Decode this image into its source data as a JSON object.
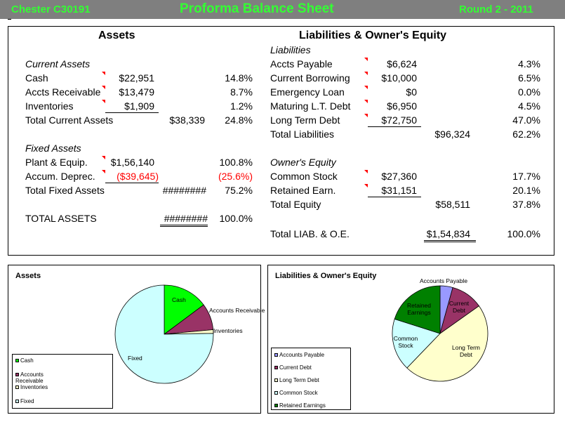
{
  "header": {
    "company": "Chester C30191",
    "title": "Proforma Balance Sheet",
    "round": "Round 2 - 2011"
  },
  "assets": {
    "heading": "Assets",
    "current_heading": "Current Assets",
    "cash": {
      "label": "Cash",
      "value": "$22,951",
      "pct": "14.8%"
    },
    "receivable": {
      "label": "Accts Receivable",
      "value": "$13,479",
      "pct": "8.7%"
    },
    "inventories": {
      "label": "Inventories",
      "value": "$1,909",
      "pct": "1.2%"
    },
    "total_current": {
      "label": "Total Current Assets",
      "value": "$38,339",
      "pct": "24.8%"
    },
    "fixed_heading": "Fixed Assets",
    "plant": {
      "label": "Plant & Equip.",
      "value": "$1,56,140",
      "pct": "100.8%"
    },
    "deprec": {
      "label": "Accum. Deprec.",
      "value": "($39,645)",
      "pct": "(25.6%)"
    },
    "total_fixed": {
      "label": "Total Fixed Assets",
      "value": "########",
      "pct": "75.2%"
    },
    "total": {
      "label": "TOTAL ASSETS",
      "value": "########",
      "pct": "100.0%"
    }
  },
  "liabilities": {
    "heading": "Liabilities & Owner's Equity",
    "liab_heading": "Liabilities",
    "payable": {
      "label": "Accts Payable",
      "value": "$6,624",
      "pct": "4.3%"
    },
    "borrowing": {
      "label": "Current Borrowing",
      "value": "$10,000",
      "pct": "6.5%"
    },
    "emergency": {
      "label": "Emergency Loan",
      "value": "$0",
      "pct": "0.0%"
    },
    "maturing": {
      "label": "Maturing L.T. Debt",
      "value": "$6,950",
      "pct": "4.5%"
    },
    "longterm": {
      "label": "Long Term Debt",
      "value": "$72,750",
      "pct": "47.0%"
    },
    "total_liab": {
      "label": "Total Liabilities",
      "value": "$96,324",
      "pct": "62.2%"
    },
    "equity_heading": "Owner's Equity",
    "common": {
      "label": "Common Stock",
      "value": "$27,360",
      "pct": "17.7%"
    },
    "retained": {
      "label": "Retained Earn.",
      "value": "$31,151",
      "pct": "20.1%"
    },
    "total_equity": {
      "label": "Total Equity",
      "value": "$58,511",
      "pct": "37.8%"
    },
    "total": {
      "label": "Total LIAB. & O.E.",
      "value": "$1,54,834",
      "pct": "100.0%"
    }
  },
  "chart_data": [
    {
      "type": "pie",
      "title": "Assets",
      "categories": [
        "Cash",
        "Accounts Receivable",
        "Inventories",
        "Fixed"
      ],
      "slice_labels": [
        "Cash",
        "Accounts Receivable",
        "Inventories",
        "Fixed"
      ],
      "legend": [
        "Cash",
        "Accounts Receivable",
        "Inventories",
        "Fixed"
      ],
      "values": [
        14.8,
        8.7,
        1.2,
        75.2
      ],
      "colors": [
        "#00ff00",
        "#993366",
        "#ffffcc",
        "#ccffff"
      ],
      "legend_position": "bottom-left"
    },
    {
      "type": "pie",
      "title": "Liabilities & Owner's Equity",
      "categories": [
        "Accounts Payable",
        "Current Debt",
        "Long Term Debt",
        "Common Stock",
        "Retained Earnings"
      ],
      "slice_labels": [
        "Accounts Payable",
        "Current Debt",
        "Long Term Debt",
        "Common Stock",
        "Retained Earnings"
      ],
      "legend": [
        "Accounts  Payable",
        "Current Debt",
        "Long Term Debt",
        "Common Stock",
        "Retained Earnings"
      ],
      "values": [
        4.3,
        10.9,
        47.0,
        17.7,
        20.1
      ],
      "colors": [
        "#9999ff",
        "#993366",
        "#ffffcc",
        "#ccffff",
        "#008000"
      ],
      "legend_position": "bottom-left"
    }
  ]
}
